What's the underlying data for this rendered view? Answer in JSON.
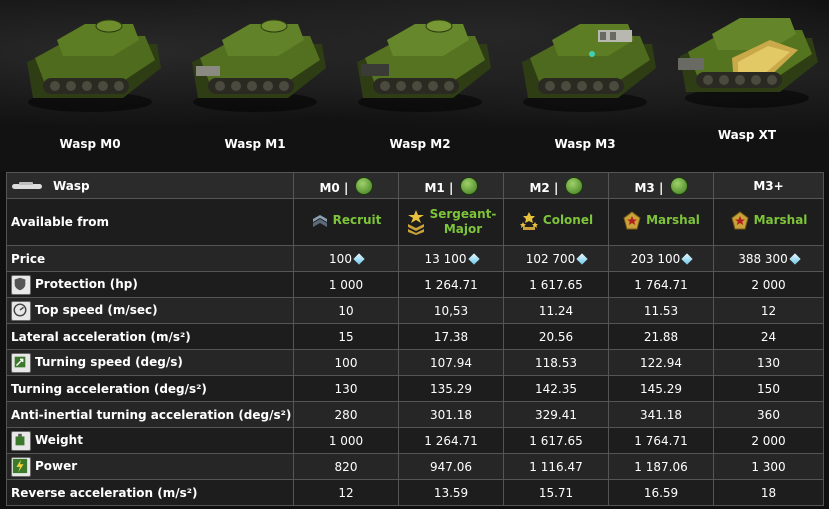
{
  "hero": {
    "tanks": [
      {
        "name": "Wasp M0"
      },
      {
        "name": "Wasp M1"
      },
      {
        "name": "Wasp M2"
      },
      {
        "name": "Wasp M3"
      },
      {
        "name": "Wasp XT"
      }
    ]
  },
  "table": {
    "hull_name": "Wasp",
    "columns": [
      "M0 |",
      "M1 |",
      "M2 |",
      "M3 |",
      "M3+"
    ],
    "available_from": {
      "label": "Available from",
      "ranks": [
        "Recruit",
        "Sergeant-Major",
        "Colonel",
        "Marshal",
        "Marshal"
      ]
    },
    "rows": [
      {
        "label": "Price",
        "icon": "",
        "values": [
          "100",
          "13 100",
          "102 700",
          "203 100",
          "388 300"
        ],
        "crystal": true
      },
      {
        "label": "Protection (hp)",
        "icon": "shield-icon",
        "values": [
          "1 000",
          "1 264.71",
          "1 617.65",
          "1 764.71",
          "2 000"
        ]
      },
      {
        "label": "Top speed (m/sec)",
        "icon": "speedometer-icon",
        "values": [
          "10",
          "10,53",
          "11.24",
          "11.53",
          "12"
        ]
      },
      {
        "label": "Lateral acceleration (m/s²)",
        "icon": "",
        "values": [
          "15",
          "17.38",
          "20.56",
          "21.88",
          "24"
        ]
      },
      {
        "label": "Turning speed (deg/s)",
        "icon": "turning-icon",
        "values": [
          "100",
          "107.94",
          "118.53",
          "122.94",
          "130"
        ]
      },
      {
        "label": "Turning acceleration (deg/s²)",
        "icon": "",
        "values": [
          "130",
          "135.29",
          "142.35",
          "145.29",
          "150"
        ]
      },
      {
        "label": "Anti-inertial turning acceleration (deg/s²)",
        "icon": "",
        "values": [
          "280",
          "301.18",
          "329.41",
          "341.18",
          "360"
        ]
      },
      {
        "label": "Weight",
        "icon": "weight-icon",
        "values": [
          "1 000",
          "1 264.71",
          "1 617.65",
          "1 764.71",
          "2 000"
        ]
      },
      {
        "label": "Power",
        "icon": "lightning-icon",
        "values": [
          "820",
          "947.06",
          "1 116.47",
          "1 187.06",
          "1 300"
        ]
      },
      {
        "label": "Reverse acceleration (m/s²)",
        "icon": "",
        "values": [
          "12",
          "13.59",
          "15.71",
          "16.59",
          "18"
        ]
      }
    ]
  },
  "colors": {
    "rank_green": "#7ec43a",
    "tank_green": "#4f6b1e",
    "xt_gold": "#c9a94a"
  }
}
